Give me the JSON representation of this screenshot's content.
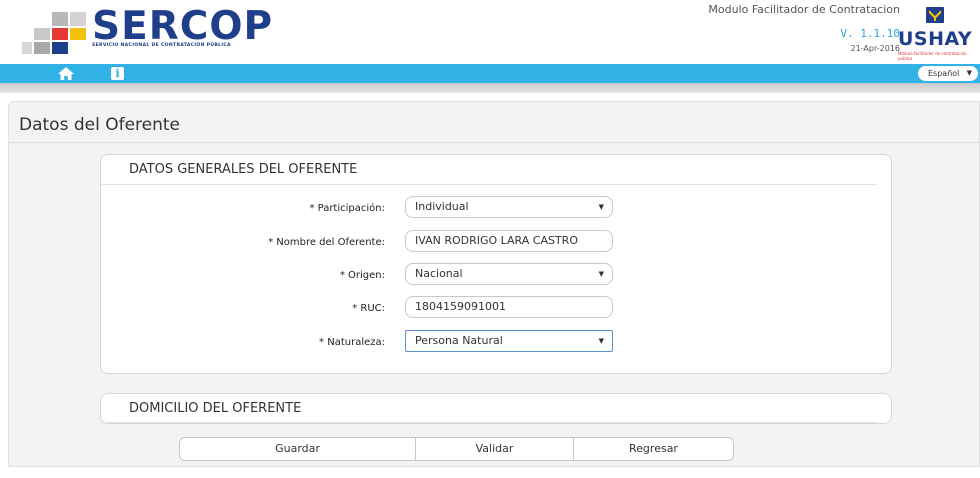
{
  "header": {
    "brand_name": "SERCOP",
    "brand_subtitle": "SERVICIO NACIONAL DE CONTRATACIÓN PÚBLICA",
    "module_title": "Modulo Facilitador de Contratacion",
    "version": "V. 1.1.10",
    "date": "21-Apr-2016",
    "partner_name": "USHAY",
    "partner_subtitle": "Módulo facilitador de contratación pública",
    "brand_color": "#1f3f8a",
    "accent_color": "#30b2e6"
  },
  "nav": {
    "home_icon": "home-icon",
    "info_icon": "info-icon",
    "info_glyph": "i",
    "language": "Español"
  },
  "page": {
    "title": "Datos del Oferente"
  },
  "general_section": {
    "heading": "DATOS GENERALES DEL OFERENTE",
    "fields": [
      {
        "label": "* Participación:",
        "value": "Individual",
        "type": "select"
      },
      {
        "label": "* Nombre del Oferente:",
        "value": "IVAN RODRIGO LARA CASTRO",
        "type": "text"
      },
      {
        "label": "* Origen:",
        "value": "Nacional",
        "type": "select"
      },
      {
        "label": "* RUC:",
        "value": "1804159091001",
        "type": "text"
      },
      {
        "label": "* Naturaleza:",
        "value": "Persona Natural",
        "type": "select"
      }
    ]
  },
  "domicilio_section": {
    "heading": "DOMICILIO DEL OFERENTE"
  },
  "actions": {
    "save": "Guardar",
    "validate": "Validar",
    "back": "Regresar"
  }
}
